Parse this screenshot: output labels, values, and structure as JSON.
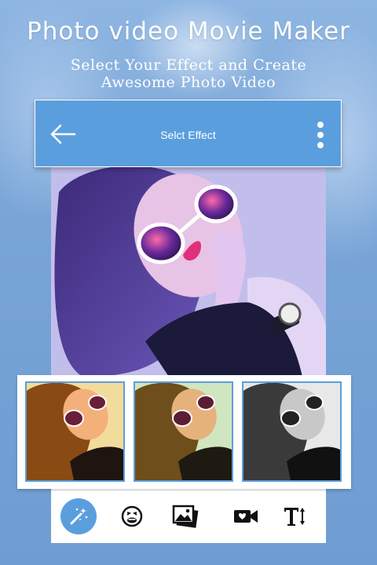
{
  "promo": {
    "title": "Photo video Movie Maker",
    "subtitle_line1": "Select Your Effect and Create",
    "subtitle_line2": "Awesome Photo Video"
  },
  "appbar": {
    "title": "Selct Effect",
    "back_icon": "arrow-left-icon",
    "menu_icon": "more-vertical-icon"
  },
  "filters": [
    {
      "name": "warm-filter"
    },
    {
      "name": "vintage-filter"
    },
    {
      "name": "grayscale-filter"
    }
  ],
  "toolbar": {
    "items": [
      {
        "icon": "magic-wand-icon",
        "active": true
      },
      {
        "icon": "emoji-sticker-icon",
        "active": false
      },
      {
        "icon": "gallery-icon",
        "active": false
      },
      {
        "icon": "video-camera-icon",
        "active": false
      },
      {
        "icon": "text-size-icon",
        "active": false
      }
    ]
  },
  "colors": {
    "accent": "#5b9ede",
    "background": "#7fa9d9"
  }
}
